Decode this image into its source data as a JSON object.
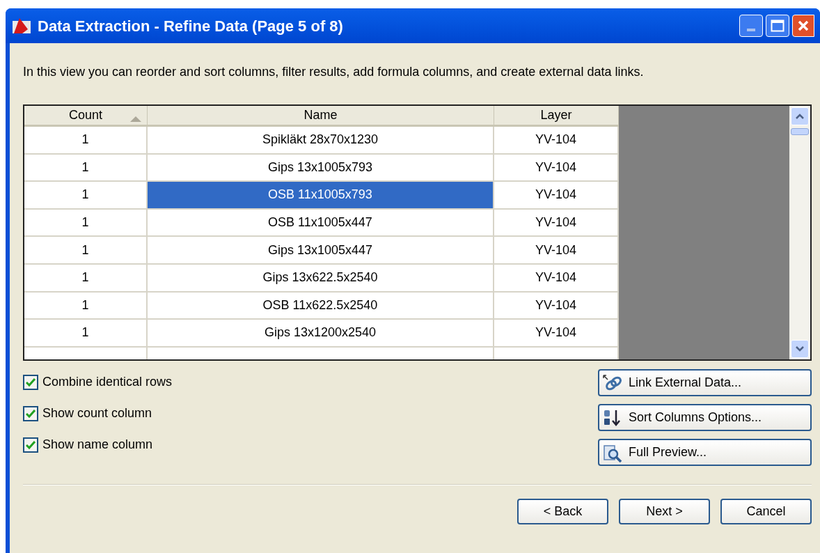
{
  "window": {
    "title": "Data Extraction - Refine Data (Page 5 of 8)"
  },
  "description": "In this view you can reorder and sort columns, filter results, add formula columns, and create external data links.",
  "table": {
    "columns": [
      {
        "label": "Count",
        "sorted": true
      },
      {
        "label": "Name",
        "sorted": false
      },
      {
        "label": "Layer",
        "sorted": false
      }
    ],
    "rows": [
      {
        "cells": [
          "1",
          "Spikläkt 28x70x1230",
          "YV-104"
        ],
        "selected": false
      },
      {
        "cells": [
          "1",
          "Gips 13x1005x793",
          "YV-104"
        ],
        "selected": false
      },
      {
        "cells": [
          "1",
          "OSB 11x1005x793",
          "YV-104"
        ],
        "selected": true
      },
      {
        "cells": [
          "1",
          "OSB 11x1005x447",
          "YV-104"
        ],
        "selected": false
      },
      {
        "cells": [
          "1",
          "Gips 13x1005x447",
          "YV-104"
        ],
        "selected": false
      },
      {
        "cells": [
          "1",
          "Gips 13x622.5x2540",
          "YV-104"
        ],
        "selected": false
      },
      {
        "cells": [
          "1",
          "OSB 11x622.5x2540",
          "YV-104"
        ],
        "selected": false
      },
      {
        "cells": [
          "1",
          "Gips 13x1200x2540",
          "YV-104"
        ],
        "selected": false
      }
    ]
  },
  "options": [
    {
      "label": "Combine identical rows",
      "checked": true
    },
    {
      "label": "Show count column",
      "checked": true
    },
    {
      "label": "Show name column",
      "checked": true
    }
  ],
  "side_buttons": [
    {
      "label": "Link External Data...",
      "kind": "link"
    },
    {
      "label": "Sort Columns Options...",
      "kind": "sort"
    },
    {
      "label": "Full Preview...",
      "kind": "preview"
    }
  ],
  "nav_buttons": [
    "< Back",
    "Next >",
    "Cancel"
  ]
}
